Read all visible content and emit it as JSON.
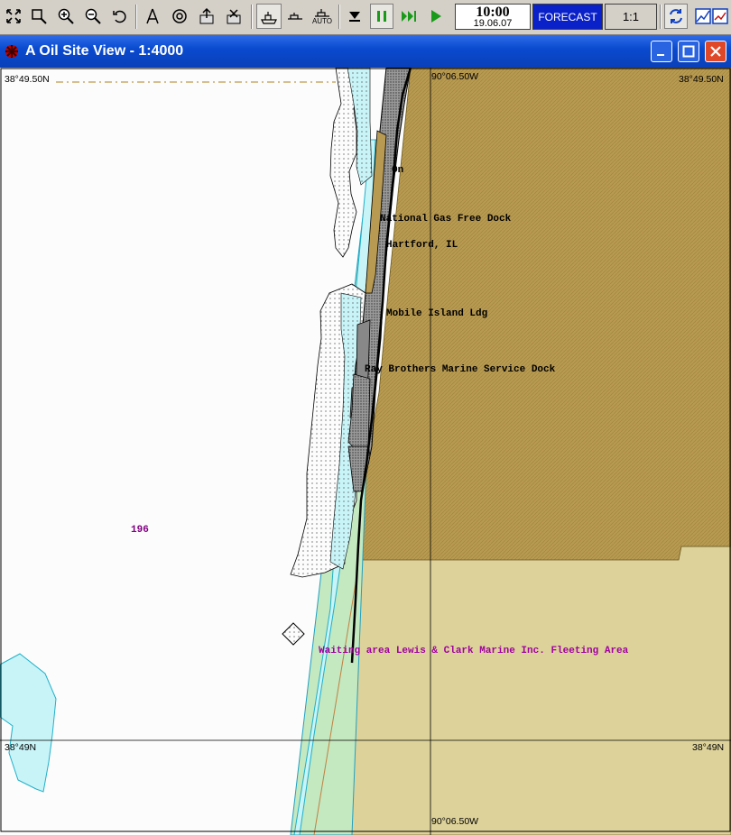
{
  "toolbar": {
    "time": "10:00",
    "date": "19.06.07",
    "forecast_label": "FORECAST",
    "ratio_label": "1:1",
    "auto_label": "AUTO"
  },
  "window": {
    "title": "A Oil Site View - 1:4000"
  },
  "map": {
    "coords": {
      "top_left_lat": "38°49.50N",
      "top_right_lat": "38°49.50N",
      "bottom_left_lat": "38°49N",
      "bottom_right_lat": "38°49N",
      "top_lon": "90°06.50W",
      "bottom_lon": "90°06.50W"
    },
    "labels": {
      "on": "On",
      "national_gas": "National Gas Free Dock",
      "hartford": "Hartford, IL",
      "mobile_island": "Mobile Island Ldg",
      "brothers_marine": "Ray Brothers Marine Service Dock",
      "depth": "196",
      "waiting_area": "Waiting area Lewis & Clark Marine Inc. Fleeting Area"
    },
    "colors": {
      "land": "#b89a52",
      "land_light": "#ddd29a",
      "water": "#c8f4f8",
      "channel": "#c4e8c0",
      "waiting_label": "#a000a0",
      "depth_label": "#800080"
    }
  }
}
